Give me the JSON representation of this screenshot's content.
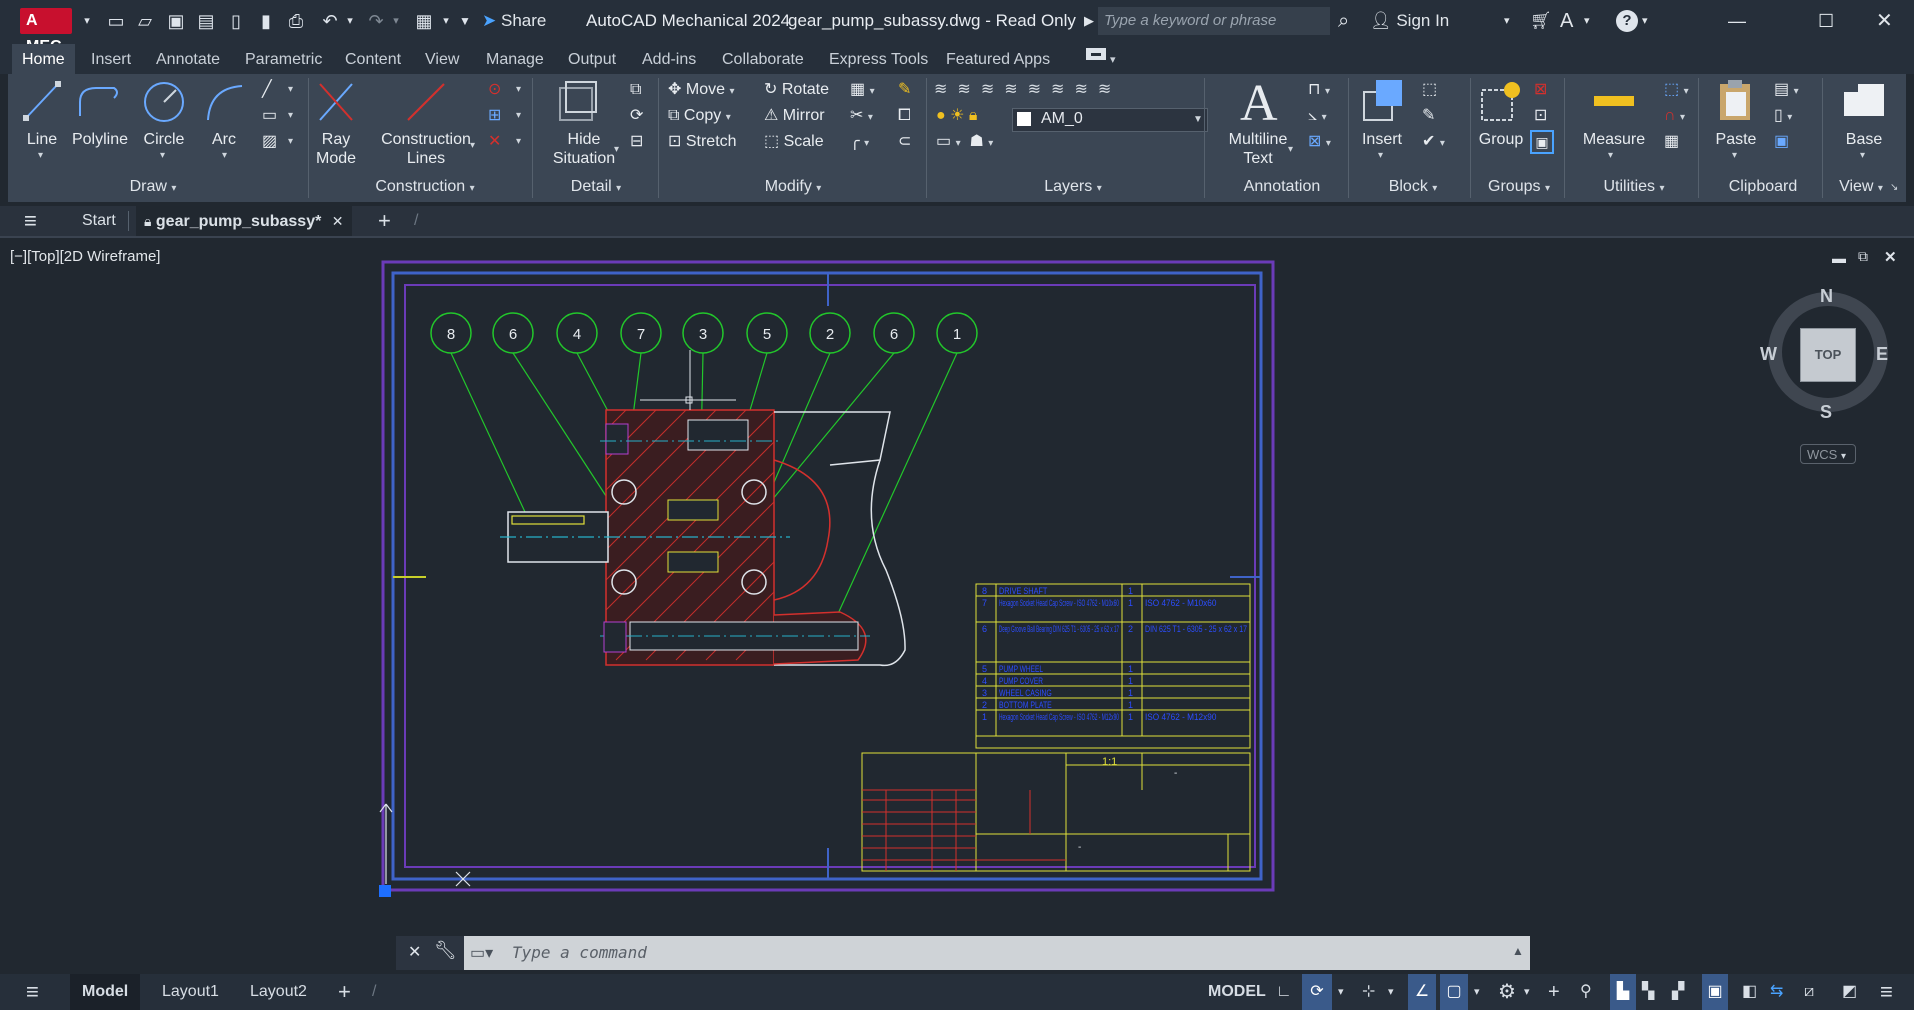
{
  "app": {
    "logo_text": "A MEC",
    "title": "AutoCAD Mechanical 2024",
    "filename": "gear_pump_subassy.dwg - Read Only",
    "share_label": "Share",
    "search_placeholder": "Type a keyword or phrase",
    "sign_in_label": "Sign In",
    "help_label": "?"
  },
  "ribbon_tabs": [
    "Home",
    "Insert",
    "Annotate",
    "Parametric",
    "Content",
    "View",
    "Manage",
    "Output",
    "Add-ins",
    "Collaborate",
    "Express Tools",
    "Featured Apps"
  ],
  "panels": {
    "draw": {
      "title": "Draw",
      "line": "Line",
      "polyline": "Polyline",
      "circle": "Circle",
      "arc": "Arc"
    },
    "construction": {
      "title": "Construction",
      "ray_mode_1": "Ray",
      "ray_mode_2": "Mode",
      "cons_lines_1": "Construction",
      "cons_lines_2": "Lines"
    },
    "detail": {
      "title": "Detail",
      "hide_1": "Hide",
      "hide_2": "Situation"
    },
    "modify": {
      "title": "Modify",
      "move": "Move",
      "copy": "Copy",
      "stretch": "Stretch",
      "rotate": "Rotate",
      "mirror": "Mirror",
      "scale": "Scale"
    },
    "layers": {
      "title": "Layers",
      "current_layer": "AM_0"
    },
    "annotation": {
      "title": "Annotation",
      "mtext_1": "Multiline",
      "mtext_2": "Text"
    },
    "block": {
      "title": "Block",
      "insert": "Insert"
    },
    "groups": {
      "title": "Groups",
      "group": "Group"
    },
    "utilities": {
      "title": "Utilities",
      "measure": "Measure"
    },
    "clipboard": {
      "title": "Clipboard",
      "paste": "Paste"
    },
    "view": {
      "title": "View",
      "base": "Base"
    }
  },
  "doc_tabs": {
    "start": "Start",
    "active": "gear_pump_subassy*"
  },
  "viewport": {
    "label": "[−][Top][2D Wireframe]",
    "viewcube": {
      "top": "TOP",
      "n": "N",
      "s": "S",
      "e": "E",
      "w": "W",
      "wcs": "WCS"
    },
    "balloons": [
      "8",
      "6",
      "4",
      "7",
      "3",
      "5",
      "2",
      "6",
      "1"
    ],
    "bom": [
      {
        "item": "8",
        "desc": "DRIVE SHAFT",
        "qty": "1",
        "std": ""
      },
      {
        "item": "7",
        "desc": "Hexagon Socket Head Cap Screw - ISO 4762 - M10x60",
        "qty": "1",
        "std": "ISO 4762 - M10x60"
      },
      {
        "item": "6",
        "desc": "Deep Groove Ball Bearing DIN 625 T1 - 6305 - 25 x 62 x 17",
        "qty": "2",
        "std": "DIN 625 T1 - 6305 - 25 x 62 x 17"
      },
      {
        "item": "5",
        "desc": "PUMP WHEEL",
        "qty": "1",
        "std": ""
      },
      {
        "item": "4",
        "desc": "PUMP COVER",
        "qty": "1",
        "std": ""
      },
      {
        "item": "3",
        "desc": "WHEEL CASING",
        "qty": "1",
        "std": ""
      },
      {
        "item": "2",
        "desc": "BOTTOM PLATE",
        "qty": "1",
        "std": ""
      },
      {
        "item": "1",
        "desc": "Hexagon Socket Head Cap Screw - ISO 4762 - M12x90",
        "qty": "1",
        "std": "ISO 4762 - M12x90"
      }
    ],
    "title_block": {
      "scale": "1:1",
      "dash": "-"
    }
  },
  "command_line": {
    "placeholder": "Type a command"
  },
  "status": {
    "model_tab": "Model",
    "layout1": "Layout1",
    "layout2": "Layout2",
    "model_btn": "MODEL"
  },
  "colors": {
    "accent": "#4aa3ff",
    "brand": "#c8102e",
    "frame_blue": "#3f63c8",
    "frame_purple": "#6b3bb8",
    "balloon_green": "#22c72b",
    "hatch_red": "#d3302d",
    "bom_yellow": "#e0e03a",
    "bom_text_blue": "#2c4dff"
  }
}
